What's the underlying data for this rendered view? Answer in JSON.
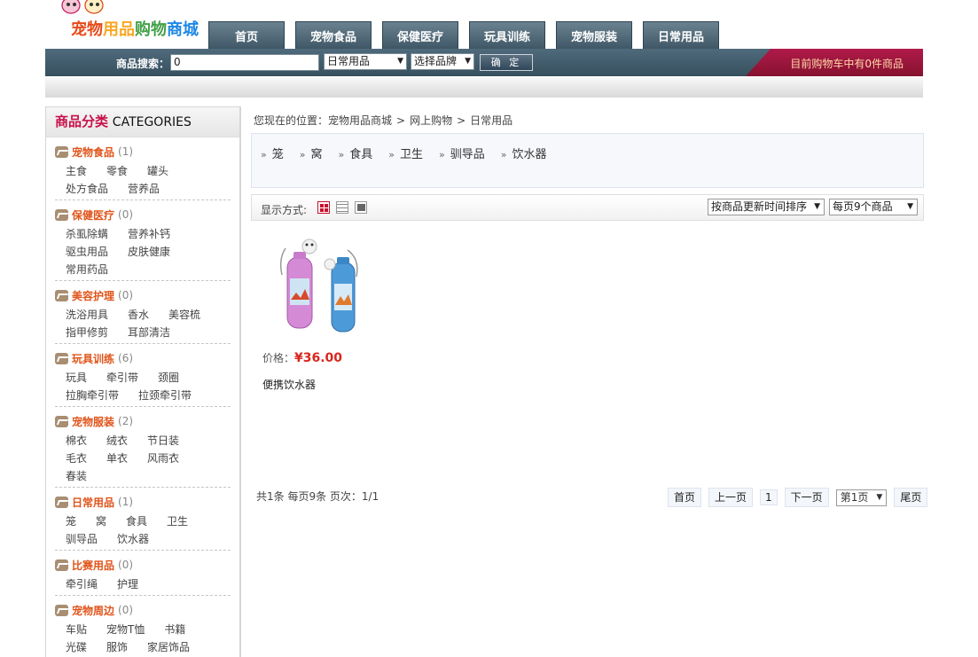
{
  "logo": {
    "text": "宠物用品购物商城"
  },
  "nav": [
    "首页",
    "宠物食品",
    "保健医疗",
    "玩具训练",
    "宠物服装",
    "日常用品"
  ],
  "search": {
    "label": "商品搜索：",
    "value": "0",
    "category_selected": "日常用品",
    "brand_selected": "选择品牌",
    "confirm_label": "确 定"
  },
  "cart": {
    "text": "目前购物车中有0件商品"
  },
  "sidebar": {
    "title_cn": "商品分类",
    "title_en": "CATEGORIES",
    "groups": [
      {
        "name": "宠物食品",
        "count": "(1)",
        "items": [
          "主食",
          "零食",
          "罐头",
          "处方食品",
          "营养品"
        ]
      },
      {
        "name": "保健医疗",
        "count": "(0)",
        "items": [
          "杀虱除螨",
          "营养补钙",
          "驱虫用品",
          "皮肤健康",
          "常用药品"
        ]
      },
      {
        "name": "美容护理",
        "count": "(0)",
        "items": [
          "洗浴用具",
          "香水",
          "美容梳",
          "指甲修剪",
          "耳部清洁"
        ]
      },
      {
        "name": "玩具训练",
        "count": "(6)",
        "items": [
          "玩具",
          "牵引带",
          "颈圈",
          "拉胸牵引带",
          "拉颈牵引带"
        ]
      },
      {
        "name": "宠物服装",
        "count": "(2)",
        "items": [
          "棉衣",
          "绒衣",
          "节日装",
          "毛衣",
          "单衣",
          "风雨衣",
          "春装"
        ]
      },
      {
        "name": "日常用品",
        "count": "(1)",
        "items": [
          "笼",
          "窝",
          "食具",
          "卫生",
          "驯导品",
          "饮水器"
        ]
      },
      {
        "name": "比赛用品",
        "count": "(0)",
        "items": [
          "牵引绳",
          "护理"
        ]
      },
      {
        "name": "宠物周边",
        "count": "(0)",
        "items": [
          "车贴",
          "宠物T恤",
          "书籍",
          "光碟",
          "服饰",
          "家居饰品"
        ]
      }
    ]
  },
  "breadcrumb": {
    "prefix": "您现在的位置：",
    "items": [
      "宠物用品商城",
      "网上购物",
      "日常用品"
    ],
    "separator": ">"
  },
  "subcategories": [
    "笼",
    "窝",
    "食具",
    "卫生",
    "驯导品",
    "饮水器"
  ],
  "toolbar": {
    "display_label": "显示方式:",
    "sort_selected": "按商品更新时间排序",
    "per_page_selected": "每页9个商品"
  },
  "product": {
    "price_label": "价格：",
    "price": "¥36.00",
    "name": "便携饮水器"
  },
  "pager": {
    "info": "共1条 每页9条 页次：1/1",
    "first": "首页",
    "prev": "上一页",
    "current": "1",
    "next": "下一页",
    "page_select": "第1页",
    "last": "尾页"
  },
  "colors": {
    "nav_bg": "#4f6a7b",
    "cart_bg": "#9c1540",
    "accent_orange": "#e0541a",
    "price_red": "#d8261d",
    "category_title": "#c8104a"
  }
}
